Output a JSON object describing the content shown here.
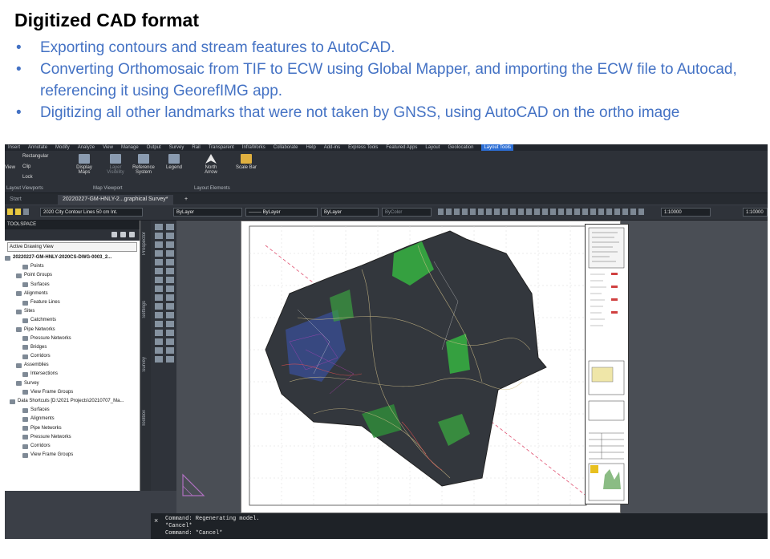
{
  "slide": {
    "title": "Digitized CAD format",
    "bullets": [
      "Exporting contours and stream features to AutoCAD.",
      "Converting Orthomosaic from TIF to ECW using Global Mapper, and importing the ECW file to Autocad, referencing it using GeorefIMG app.",
      "Digitizing all other landmarks that were not taken by GNSS, using AutoCAD on the ortho image"
    ],
    "bullet_symbol": "•",
    "bullet_color": "#4472c4"
  },
  "ribbon": {
    "tabs": [
      "Insert",
      "Annotate",
      "Modify",
      "Analyze",
      "View",
      "Manage",
      "Output",
      "Survey",
      "Rail",
      "Transparent",
      "InfraWorks",
      "Collaborate",
      "Help",
      "Add-ins",
      "Express Tools",
      "Featured Apps",
      "Layout",
      "Geolocation",
      "Layout Tools"
    ],
    "active_tab": "Layout Tools",
    "items": {
      "rectangular": "Rectangular",
      "clip": "Clip",
      "lock": "Lock",
      "view": "View",
      "display_maps": "Display Maps",
      "layer_visibility": "Layer Visibility",
      "reference_system": "Reference System",
      "legend": "Legend",
      "north_arrow": "North Arrow",
      "scale_bar": "Scale Bar"
    },
    "groups": {
      "layout_viewports": "Layout Viewports",
      "map_viewport": "Map Viewport",
      "layout_elements": "Layout Elements"
    }
  },
  "doc_tabs": {
    "start": "Start",
    "drawing": "20220227-GM-HNLY-2...graphical Survey*",
    "add": "+"
  },
  "toolbar": {
    "layer": "2020 City Contour Lines 50 cm Int.",
    "color": "ByLayer",
    "linetype": "-------- ByLayer",
    "lineweight": "ByLayer",
    "plotstyle": "ByColor",
    "scale1": "1:10000",
    "scale2": "1:10000"
  },
  "toolspace": {
    "title": "TOOLSPACE",
    "view_mode": "Active Drawing View",
    "drawing_root": "20220227-GM-HNLY-2020CS-DWG-0003_2...",
    "drawing_items": [
      "Points",
      "Point Groups",
      "Surfaces",
      "Alignments",
      "Feature Lines",
      "Sites",
      "Catchments",
      "Pipe Networks",
      "Pressure Networks",
      "Bridges",
      "Corridors",
      "Assemblies",
      "Intersections",
      "Survey",
      "View Frame Groups"
    ],
    "shortcuts_root": "Data Shortcuts [D:\\2021 Projects\\20210707_Ma...",
    "shortcut_items": [
      "Surfaces",
      "Alignments",
      "Pipe Networks",
      "Pressure Networks",
      "Corridors",
      "View Frame Groups"
    ],
    "side_labels": [
      "Prospector",
      "Settings",
      "Survey",
      "Toolbox"
    ]
  },
  "command": {
    "close": "×",
    "lines": [
      "Command: Regenerating model.",
      "*Cancel*",
      "Command: *Cancel*"
    ]
  }
}
